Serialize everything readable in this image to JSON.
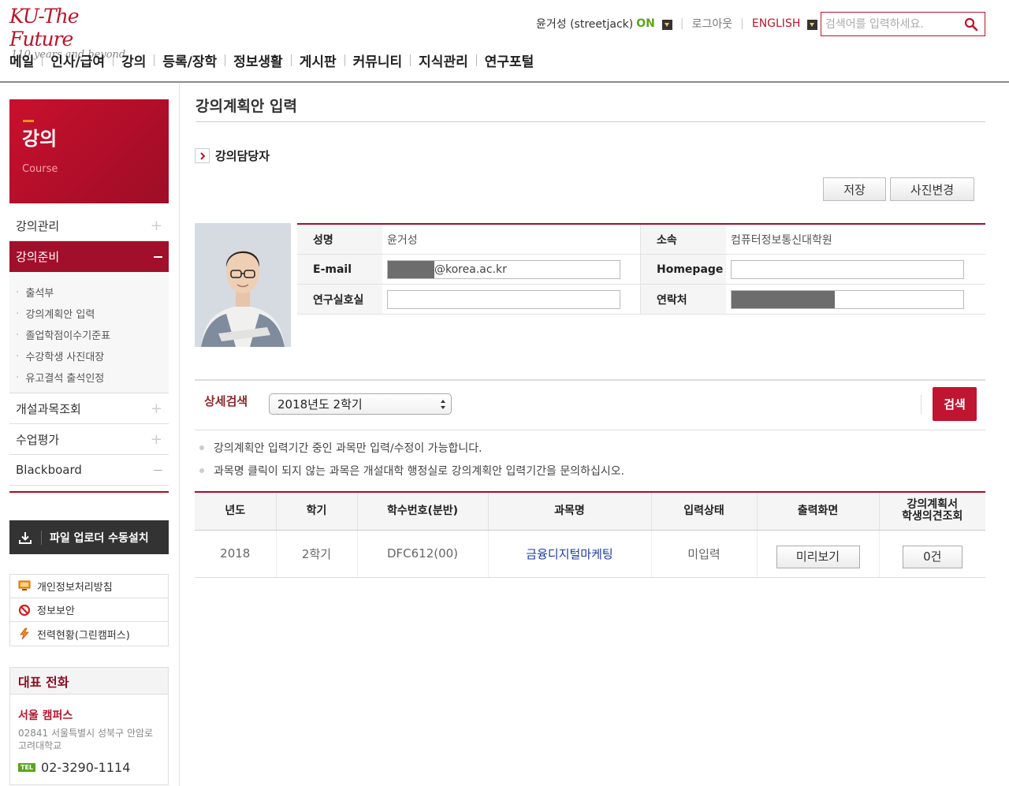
{
  "header": {
    "logo_main": "KU-The Future",
    "logo_sub": "110 years and beyond",
    "user": "윤거성 (streetjack)",
    "status": "ON",
    "logout": "로그아웃",
    "language": "ENGLISH",
    "search_placeholder": "검색어를 입력하세요."
  },
  "gnb": [
    "메일",
    "인사/급여",
    "강의",
    "등록/장학",
    "정보생활",
    "게시판",
    "커뮤니티",
    "지식관리",
    "연구포털"
  ],
  "sidebar": {
    "banner_title": "강의",
    "banner_sub": "Course",
    "items": [
      {
        "label": "강의관리"
      },
      {
        "label": "강의준비"
      },
      {
        "label": "개설과목조회"
      },
      {
        "label": "수업평가"
      },
      {
        "label": "Blackboard"
      }
    ],
    "sub_items": [
      "출석부",
      "강의계획안 입력",
      "졸업학점이수기준표",
      "수강학생 사진대장",
      "유고결석 출석인정"
    ],
    "upload_button": "파일 업로더 수동설치",
    "quick_links": [
      "개인정보처리방침",
      "정보보안",
      "전력현황(그린캠퍼스)"
    ],
    "phone": {
      "title": "대표 전화",
      "campus": "서울 캠퍼스",
      "address": "02841 서울특별시 성북구 안암로 고려대학교",
      "tel_tag": "TEL",
      "tel": "02-3290-1114"
    }
  },
  "main": {
    "title": "강의계획안 입력",
    "section": "강의담당자",
    "save_button": "저장",
    "photo_button": "사진변경",
    "info": {
      "name_label": "성명",
      "name_value": "윤거성",
      "dept_label": "소속",
      "dept_value": "컴퓨터정보통신대학원",
      "email_label": "E-mail",
      "email_value": "@korea.ac.kr",
      "homepage_label": "Homepage",
      "homepage_value": "",
      "office_label": "연구실호실",
      "office_value": "",
      "contact_label": "연락처"
    },
    "search": {
      "label": "상세검색",
      "selected": "2018년도 2학기",
      "button": "검색"
    },
    "notes": [
      "강의계획안 입력기간 중인 과목만 입력/수정이 가능합니다.",
      "과목명 클릭이 되지 않는 과목은 개설대학 행정실로 강의계획안 입력기간을 문의하십시오."
    ],
    "table": {
      "headers": [
        "년도",
        "학기",
        "학수번호(분반)",
        "과목명",
        "입력상태",
        "출력화면",
        "강의계획서\n학생의견조회"
      ],
      "rows": [
        {
          "year": "2018",
          "semester": "2학기",
          "code": "DFC612(00)",
          "course": "금융디지털마케팅",
          "status": "미입력",
          "preview": "미리보기",
          "opinions": "0건"
        }
      ]
    }
  }
}
